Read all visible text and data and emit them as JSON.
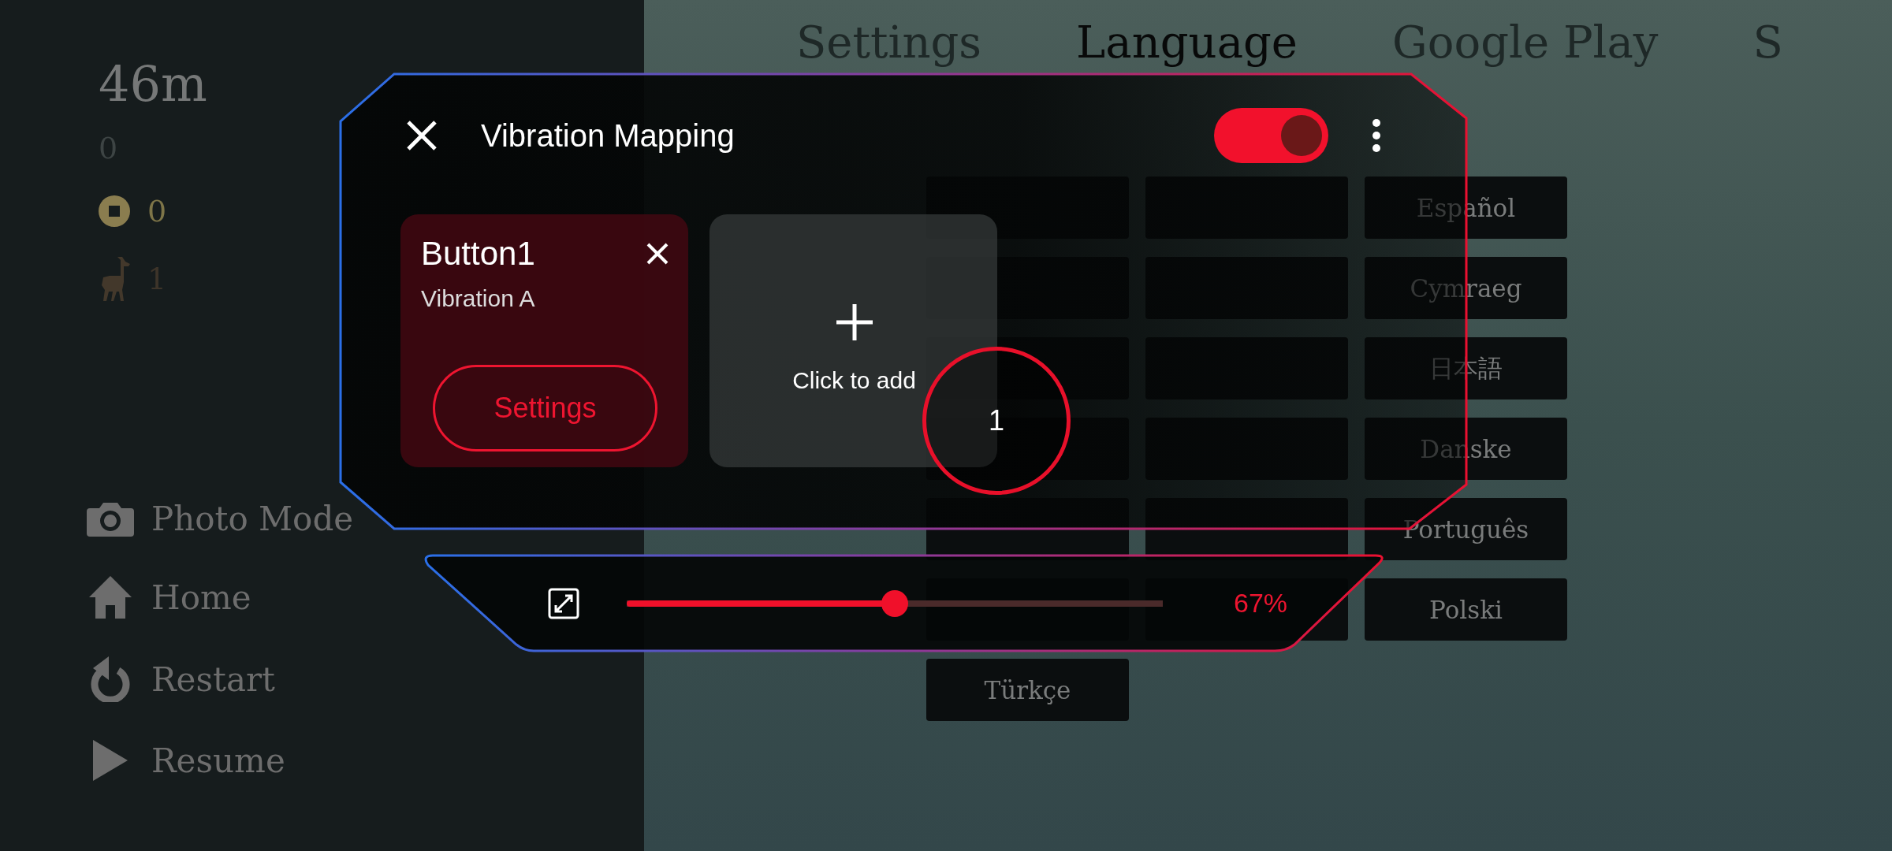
{
  "stats": {
    "distance": "46m",
    "score": "0",
    "coins": "0",
    "llamas": "1"
  },
  "menu": [
    {
      "kind": "camera",
      "label": "Photo Mode"
    },
    {
      "kind": "home",
      "label": "Home"
    },
    {
      "kind": "restart",
      "label": "Restart"
    },
    {
      "kind": "play",
      "label": "Resume"
    }
  ],
  "tabs": [
    {
      "label": "Settings",
      "selected": false
    },
    {
      "label": "Language",
      "selected": true
    },
    {
      "label": "Google Play",
      "selected": false
    },
    {
      "label": "S",
      "selected": false
    }
  ],
  "languages": [
    {
      "kind": "covered"
    },
    {
      "kind": "covered"
    },
    {
      "kind": "label",
      "label": "Español"
    },
    {
      "kind": "covered"
    },
    {
      "kind": "covered"
    },
    {
      "kind": "label",
      "label": "Cymraeg"
    },
    {
      "kind": "covered"
    },
    {
      "kind": "covered"
    },
    {
      "kind": "label",
      "label": "日本語"
    },
    {
      "kind": "covered"
    },
    {
      "kind": "covered"
    },
    {
      "kind": "label",
      "label": "Danske"
    },
    {
      "kind": "covered"
    },
    {
      "kind": "covered"
    },
    {
      "kind": "label",
      "label": "Português"
    },
    {
      "kind": "covered"
    },
    {
      "kind": "covered"
    },
    {
      "kind": "label",
      "label": "Polski"
    },
    {
      "kind": "label",
      "label": "Türkçe"
    }
  ],
  "overlay": {
    "title": "Vibration Mapping",
    "enabled": true,
    "mappings": [
      {
        "name": "Button1",
        "vibration": "Vibration A",
        "action": "Settings"
      }
    ],
    "add_label": "Click to add",
    "badge": "1",
    "intensity": {
      "level": 0.5,
      "reading": "67%"
    }
  }
}
